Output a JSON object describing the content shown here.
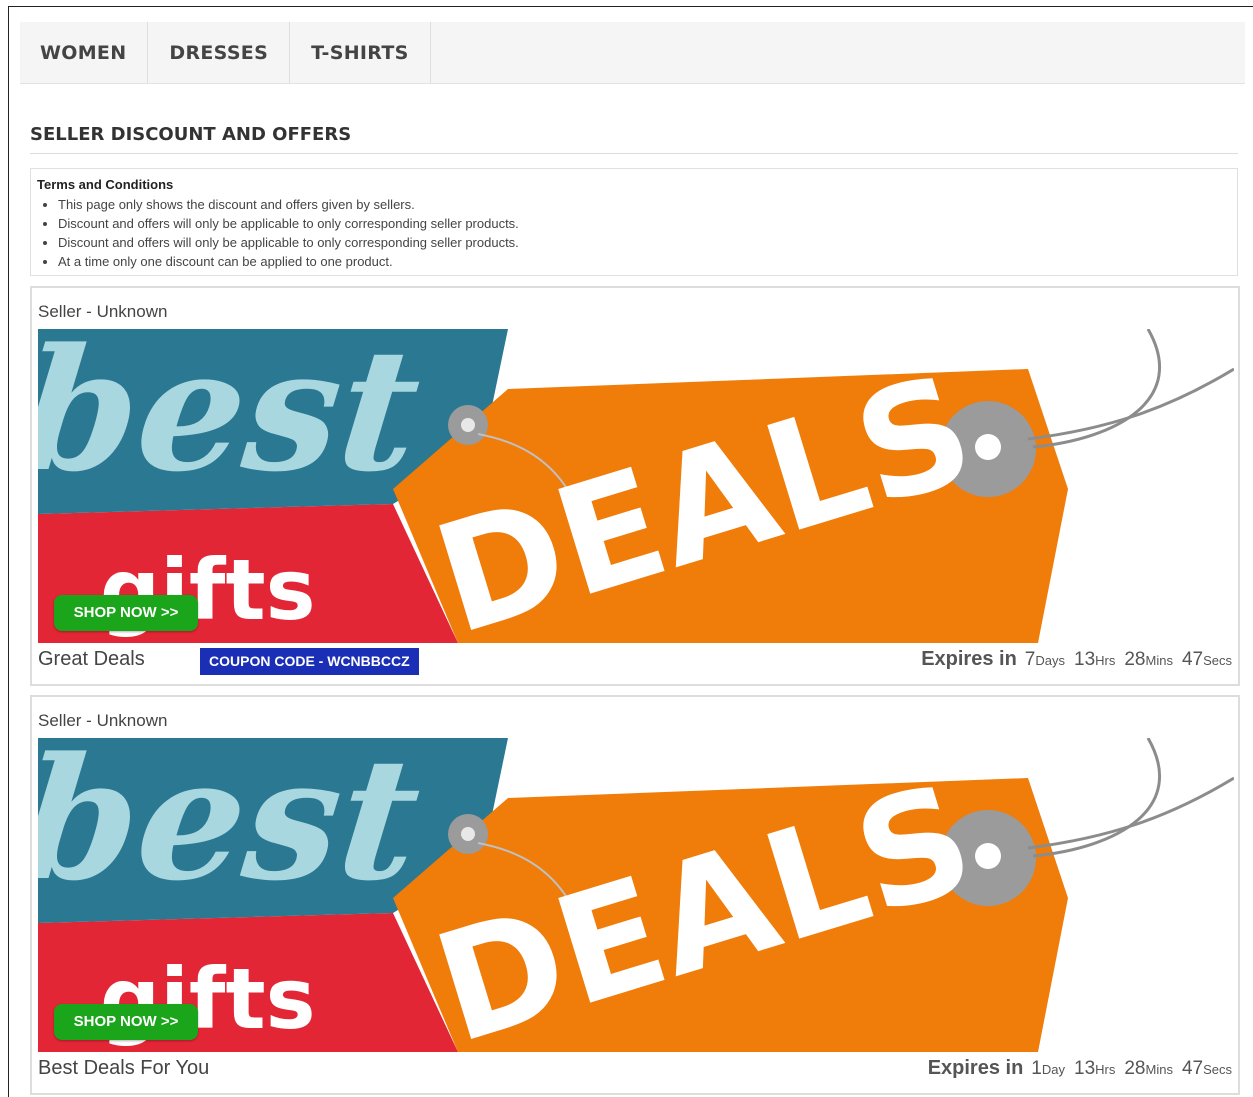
{
  "nav": {
    "items": [
      {
        "label": "WOMEN"
      },
      {
        "label": "DRESSES"
      },
      {
        "label": "T-SHIRTS"
      }
    ]
  },
  "page": {
    "title": "SELLER DISCOUNT AND OFFERS"
  },
  "terms": {
    "heading": "Terms and Conditions",
    "items": [
      "This page only shows the discount and offers given by sellers.",
      "Discount and offers will only be applicable to only corresponding seller products.",
      "Discount and offers will only be applicable to only corresponding seller products.",
      "At a time only one discount can be applied to one product."
    ]
  },
  "offers": [
    {
      "seller": "Seller - Unknown",
      "banner": {
        "word1": "best",
        "word2": "gifts",
        "word3": "DEALS"
      },
      "shop_label": "SHOP NOW >>",
      "title": "Great Deals",
      "coupon": "COUPON CODE - WCNBBCCZ",
      "expires_label": "Expires in",
      "countdown": {
        "days": "7",
        "days_unit": "Days",
        "hrs": "13",
        "hrs_unit": "Hrs",
        "mins": "28",
        "mins_unit": "Mins",
        "secs": "47",
        "secs_unit": "Secs"
      }
    },
    {
      "seller": "Seller - Unknown",
      "banner": {
        "word1": "best",
        "word2": "gifts",
        "word3": "DEALS"
      },
      "shop_label": "SHOP NOW >>",
      "title": "Best Deals For You",
      "expires_label": "Expires in",
      "countdown": {
        "days": "1",
        "days_unit": "Day",
        "hrs": "13",
        "hrs_unit": "Hrs",
        "mins": "28",
        "mins_unit": "Mins",
        "secs": "47",
        "secs_unit": "Secs"
      }
    }
  ],
  "colors": {
    "teal": "#2a7891",
    "light_blue": "#a8d7e0",
    "red": "#e32636",
    "orange": "#f07c0a",
    "gray_ring": "#9b9b9b",
    "shop_green": "#1aa51a",
    "coupon_blue": "#1a2fb5"
  }
}
